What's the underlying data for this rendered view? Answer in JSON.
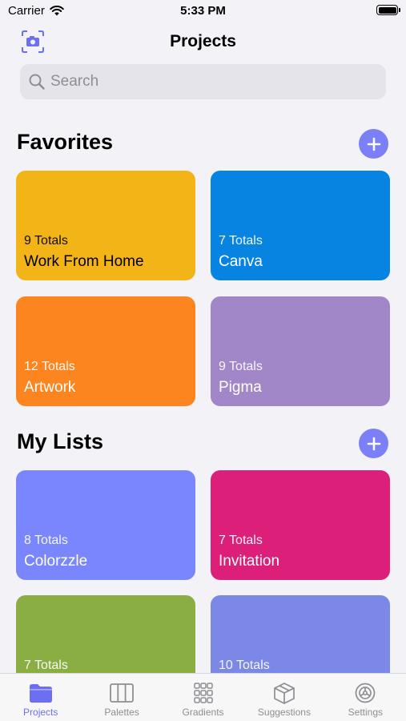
{
  "status": {
    "carrier": "Carrier",
    "time": "5:33 PM"
  },
  "nav": {
    "title": "Projects"
  },
  "search": {
    "placeholder": "Search"
  },
  "favorites": {
    "title": "Favorites",
    "cards": [
      {
        "count": "9 Totals",
        "name": "Work From Home",
        "color": "#f2b416"
      },
      {
        "count": "7 Totals",
        "name": "Canva",
        "color": "#0784e2"
      },
      {
        "count": "12 Totals",
        "name": "Artwork",
        "color": "#fd8520"
      },
      {
        "count": "9 Totals",
        "name": "Pigma",
        "color": "#a287c8"
      }
    ]
  },
  "lists": {
    "title": "My Lists",
    "cards": [
      {
        "count": "8 Totals",
        "name": "Colorzzle",
        "color": "#7a86fd"
      },
      {
        "count": "7 Totals",
        "name": "Invitation",
        "color": "#dc1f78"
      },
      {
        "count": "7 Totals",
        "name": "",
        "color": "#8aae44"
      },
      {
        "count": "10 Totals",
        "name": "",
        "color": "#7b88e5"
      }
    ]
  },
  "tabs": [
    {
      "label": "Projects",
      "icon": "folder-icon",
      "active": true
    },
    {
      "label": "Palettes",
      "icon": "palette-icon",
      "active": false
    },
    {
      "label": "Gradients",
      "icon": "grid-icon",
      "active": false
    },
    {
      "label": "Suggestions",
      "icon": "box-icon",
      "active": false
    },
    {
      "label": "Settings",
      "icon": "gear-icon",
      "active": false
    }
  ],
  "colors": {
    "accent": "#6d6ff2",
    "add_button": "#7b7ff8"
  }
}
